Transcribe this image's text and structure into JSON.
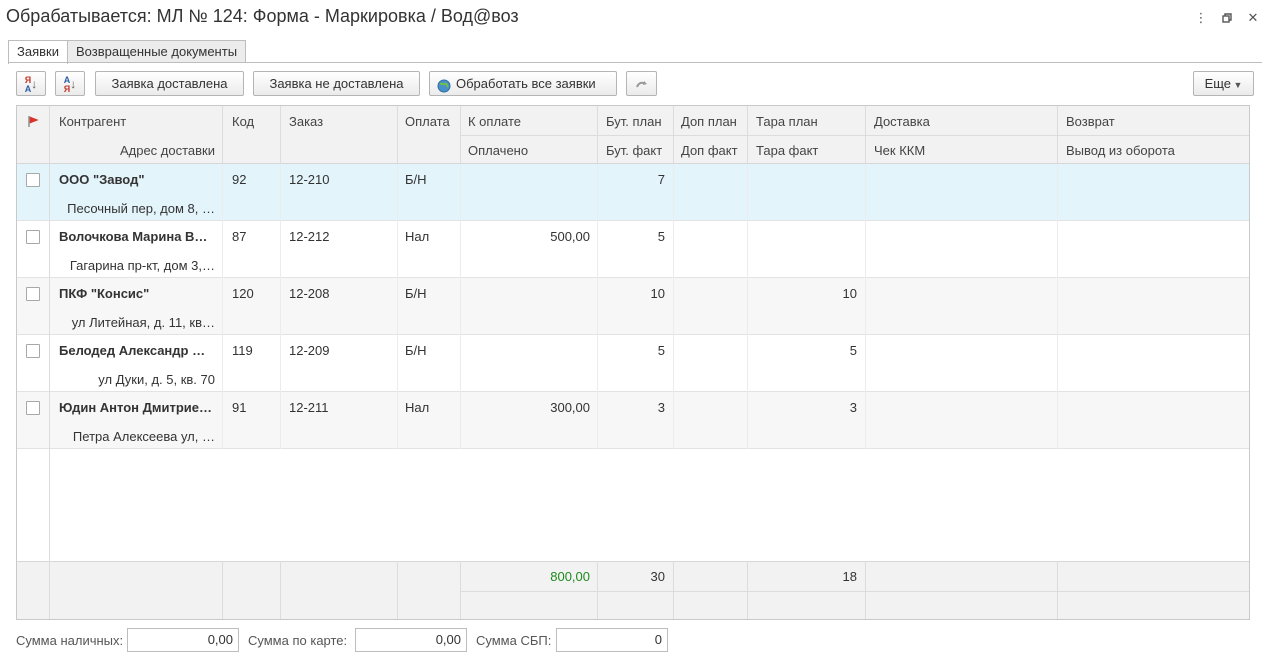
{
  "window": {
    "title": "Обрабатывается: МЛ № 124: Форма - Маркировка / Вод@воз"
  },
  "tabs": [
    {
      "label": "Заявки"
    },
    {
      "label": "Возвращенные документы"
    }
  ],
  "toolbar": {
    "delivered": "Заявка доставлена",
    "not_delivered": "Заявка не доставлена",
    "process_all": "Обработать все заявки",
    "more": "Еще"
  },
  "table": {
    "headers": {
      "contractor": "Контрагент",
      "address": "Адрес доставки",
      "code": "Код",
      "order": "Заказ",
      "payment": "Оплата",
      "to_pay": "К оплате",
      "paid": "Оплачено",
      "bottle_plan": "Бут. план",
      "bottle_fact": "Бут. факт",
      "extra_plan": "Доп план",
      "extra_fact": "Доп факт",
      "tare_plan": "Тара план",
      "tare_fact": "Тара факт",
      "delivery": "Доставка",
      "receipt": "Чек ККМ",
      "return": "Возврат",
      "withdrawal": "Вывод из оборота"
    },
    "rows": [
      {
        "contractor": "ООО \"Завод\"",
        "address": "Песочный пер,  дом 8, …",
        "code": "92",
        "order": "12-210",
        "payment": "Б/Н",
        "to_pay": "",
        "bottle_plan": "7",
        "tare_plan": ""
      },
      {
        "contractor": "Волочкова Марина В…",
        "address": "Гагарина пр-кт,  дом 3,…",
        "code": "87",
        "order": "12-212",
        "payment": "Нал",
        "to_pay": "500,00",
        "bottle_plan": "5",
        "tare_plan": ""
      },
      {
        "contractor": "ПКФ \"Консис\"",
        "address": "ул Литейная,  д. 11,  кв…",
        "code": "120",
        "order": "12-208",
        "payment": "Б/Н",
        "to_pay": "",
        "bottle_plan": "10",
        "tare_plan": "10"
      },
      {
        "contractor": "Белодед Александр …",
        "address": "ул Дуки,  д. 5,  кв. 70",
        "code": "119",
        "order": "12-209",
        "payment": "Б/Н",
        "to_pay": "",
        "bottle_plan": "5",
        "tare_plan": "5"
      },
      {
        "contractor": "Юдин Антон Дмитрие…",
        "address": "Петра Алексеева ул,  …",
        "code": "91",
        "order": "12-211",
        "payment": "Нал",
        "to_pay": "300,00",
        "bottle_plan": "3",
        "tare_plan": "3"
      }
    ],
    "totals": {
      "to_pay": "800,00",
      "bottle_plan": "30",
      "tare_plan": "18"
    }
  },
  "summary": {
    "cash_label": "Сумма наличных:",
    "cash_value": "0,00",
    "card_label": "Сумма по карте:",
    "card_value": "0,00",
    "sbp_label": "Сумма СБП:",
    "sbp_value": "0"
  },
  "colors": {
    "selected_row": "#e3f4fb",
    "total_green": "#1f8a1f",
    "flag": "#d9332b"
  }
}
